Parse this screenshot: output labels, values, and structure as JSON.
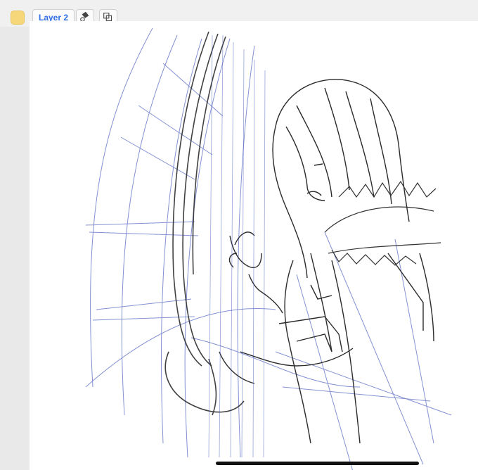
{
  "toolbar": {
    "layer_label": "Layer 2",
    "layer_color": "#f6d77a",
    "icons": [
      "paint-bucket-eraser-icon",
      "transform-crop-icon"
    ]
  },
  "canvas": {
    "background": "#ffffff"
  }
}
